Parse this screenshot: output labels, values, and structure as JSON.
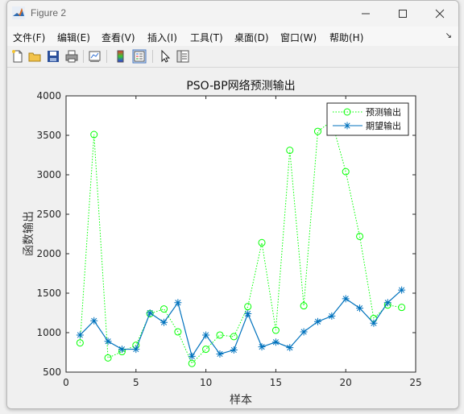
{
  "window": {
    "title": "Figure 2"
  },
  "menu": [
    {
      "label": "文件(F)"
    },
    {
      "label": "编辑(E)"
    },
    {
      "label": "查看(V)"
    },
    {
      "label": "插入(I)"
    },
    {
      "label": "工具(T)"
    },
    {
      "label": "桌面(D)"
    },
    {
      "label": "窗口(W)"
    },
    {
      "label": "帮助(H)"
    }
  ],
  "toolbar": [
    "new-figure-icon",
    "open-file-icon",
    "save-icon",
    "print-icon",
    "link-plot-icon",
    "colorbar-icon",
    "legend-icon",
    "pointer-icon",
    "property-editor-icon"
  ],
  "chart_data": {
    "type": "line",
    "title": "PSO-BP网络预测输出",
    "xlabel": "样本",
    "ylabel": "函数输出",
    "xlim": [
      0,
      25
    ],
    "ylim": [
      500,
      4000
    ],
    "xticks": [
      0,
      5,
      10,
      15,
      20,
      25
    ],
    "yticks": [
      500,
      1000,
      1500,
      2000,
      2500,
      3000,
      3500,
      4000
    ],
    "grid": false,
    "legend_position": "top-right",
    "x": [
      1,
      2,
      3,
      4,
      5,
      6,
      7,
      8,
      9,
      10,
      11,
      12,
      13,
      14,
      15,
      16,
      17,
      18,
      19,
      20,
      21,
      22,
      23,
      24
    ],
    "series": [
      {
        "name": "预测输出",
        "color": "#00ff00",
        "line": "dotted",
        "marker": "circle",
        "values": [
          870,
          3510,
          680,
          760,
          840,
          1240,
          1300,
          1010,
          610,
          790,
          970,
          950,
          1330,
          2140,
          1030,
          3310,
          1340,
          3550,
          3680,
          3040,
          2220,
          1180,
          1350,
          1320
        ]
      },
      {
        "name": "期望输出",
        "color": "#0072bd",
        "line": "solid",
        "marker": "asterisk",
        "values": [
          970,
          1150,
          890,
          790,
          790,
          1250,
          1130,
          1380,
          700,
          970,
          730,
          780,
          1240,
          820,
          880,
          810,
          1010,
          1140,
          1210,
          1430,
          1310,
          1120,
          1380,
          1540
        ]
      }
    ]
  }
}
